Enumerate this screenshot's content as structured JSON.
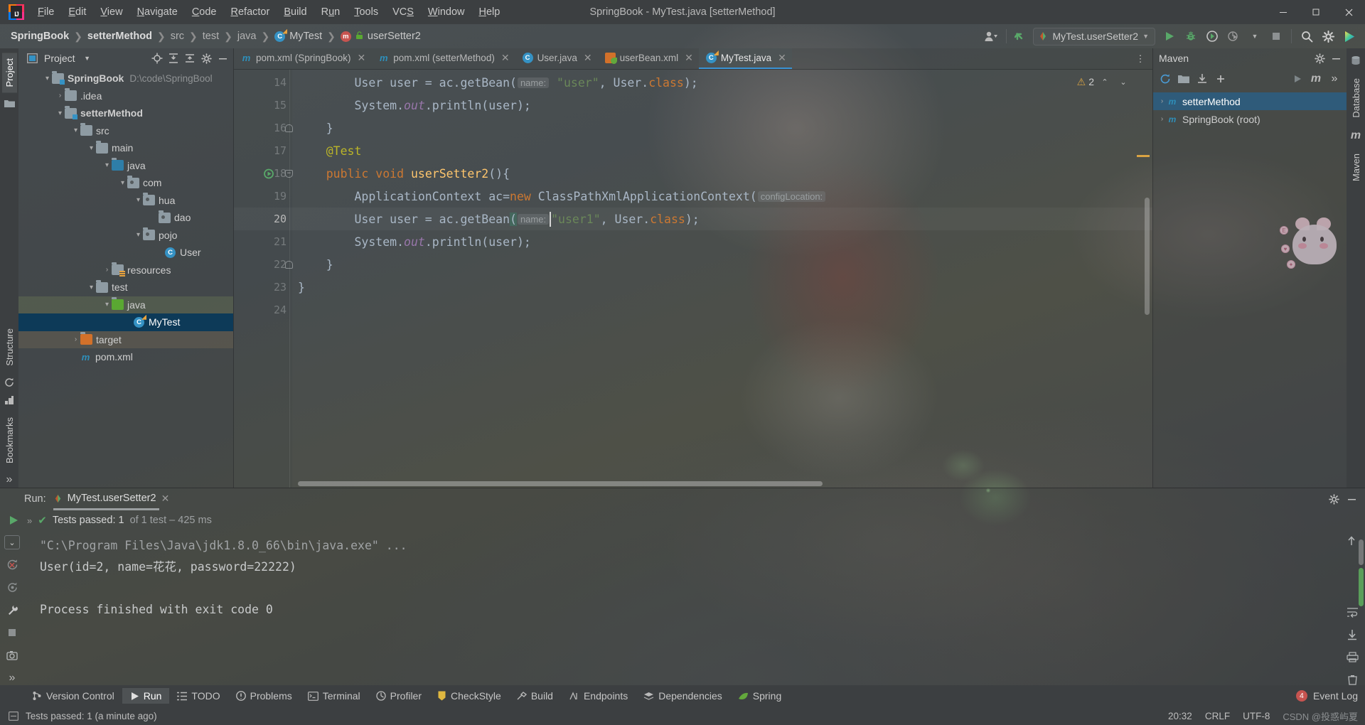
{
  "window": {
    "title": "SpringBook - MyTest.java [setterMethod]",
    "logo_text": "IJ",
    "minimize": "—",
    "maximize": "❐",
    "close": "✕"
  },
  "menu": [
    {
      "label": "File",
      "mnemonic": "F"
    },
    {
      "label": "Edit",
      "mnemonic": "E"
    },
    {
      "label": "View",
      "mnemonic": "V"
    },
    {
      "label": "Navigate",
      "mnemonic": "N"
    },
    {
      "label": "Code",
      "mnemonic": "C"
    },
    {
      "label": "Refactor",
      "mnemonic": "R"
    },
    {
      "label": "Build",
      "mnemonic": "B"
    },
    {
      "label": "Run",
      "mnemonic": "u"
    },
    {
      "label": "Tools",
      "mnemonic": "T"
    },
    {
      "label": "VCS",
      "mnemonic": "S"
    },
    {
      "label": "Window",
      "mnemonic": "W"
    },
    {
      "label": "Help",
      "mnemonic": "H"
    }
  ],
  "breadcrumbs": [
    {
      "label": "SpringBook",
      "style": "bold"
    },
    {
      "label": "setterMethod",
      "style": "bold"
    },
    {
      "label": "src",
      "style": "dim"
    },
    {
      "label": "test",
      "style": "dim"
    },
    {
      "label": "java",
      "style": "dim"
    },
    {
      "label": "MyTest",
      "style": "normal",
      "icon": "java-class-icon"
    },
    {
      "label": "userSetter2",
      "style": "normal",
      "icon": "method-icon"
    }
  ],
  "navbar_right": {
    "run_config": "MyTest.userSetter2",
    "icons": [
      "user-avatar-icon",
      "vcs-update-icon",
      "run-icon",
      "debug-icon",
      "run-with-coverage-icon",
      "profiler-icon",
      "stop-icon",
      "search-everywhere-icon",
      "settings-gear-icon",
      "ide-services-icon"
    ]
  },
  "left_stripe": {
    "tabs": [
      "Project"
    ],
    "extra_icon": "structure-folder-icon"
  },
  "right_stripe": {
    "tabs": [
      "Database",
      "Maven"
    ]
  },
  "project_panel": {
    "title": "Project",
    "toolbar_icons": [
      "locate-icon",
      "expand-all-icon",
      "collapse-all-icon",
      "settings-gear-icon",
      "hide-icon"
    ],
    "tree": [
      {
        "label": "SpringBook",
        "path": "D:\\code\\SpringBool",
        "depth": 0,
        "arrow": "open",
        "icon": "module-folder-icon",
        "bold": true
      },
      {
        "label": ".idea",
        "depth": 1,
        "arrow": "closed",
        "icon": "folder-icon"
      },
      {
        "label": "setterMethod",
        "depth": 1,
        "arrow": "open",
        "icon": "module-folder-icon",
        "bold": true
      },
      {
        "label": "src",
        "depth": 2,
        "arrow": "open",
        "icon": "folder-icon"
      },
      {
        "label": "main",
        "depth": 3,
        "arrow": "open",
        "icon": "folder-icon"
      },
      {
        "label": "java",
        "depth": 4,
        "arrow": "open",
        "icon": "source-root-icon"
      },
      {
        "label": "com",
        "depth": 5,
        "arrow": "open",
        "icon": "package-icon"
      },
      {
        "label": "hua",
        "depth": 6,
        "arrow": "open",
        "icon": "package-icon"
      },
      {
        "label": "dao",
        "depth": 7,
        "arrow": "none",
        "icon": "package-icon"
      },
      {
        "label": "pojo",
        "depth": 6,
        "arrow": "open",
        "icon": "package-icon"
      },
      {
        "label": "User",
        "depth": 7,
        "arrow": "none",
        "icon": "java-class-icon"
      },
      {
        "label": "resources",
        "depth": 4,
        "arrow": "closed",
        "icon": "resource-root-icon"
      },
      {
        "label": "test",
        "depth": 3,
        "arrow": "open",
        "icon": "folder-icon"
      },
      {
        "label": "java",
        "depth": 4,
        "arrow": "open",
        "icon": "test-source-root-icon",
        "state": "sel-java"
      },
      {
        "label": "MyTest",
        "depth": 5,
        "arrow": "none",
        "icon": "java-test-class-icon",
        "state": "sel-mytest"
      },
      {
        "label": "target",
        "depth": 2,
        "arrow": "closed",
        "icon": "excluded-folder-icon",
        "state": "sel-target"
      },
      {
        "label": "pom.xml",
        "depth": 2,
        "arrow": "none",
        "icon": "maven-icon"
      }
    ]
  },
  "editor": {
    "tabs": [
      {
        "label": "pom.xml (SpringBook)",
        "icon": "maven-icon",
        "active": false
      },
      {
        "label": "pom.xml (setterMethod)",
        "icon": "maven-icon",
        "active": false
      },
      {
        "label": "User.java",
        "icon": "java-class-icon",
        "active": false
      },
      {
        "label": "userBean.xml",
        "icon": "spring-xml-icon",
        "active": false
      },
      {
        "label": "MyTest.java",
        "icon": "java-test-class-icon",
        "active": true
      }
    ],
    "inspection": {
      "warning_count": "2"
    },
    "line_numbers": [
      "14",
      "15",
      "16",
      "17",
      "18",
      "19",
      "20",
      "21",
      "22",
      "23",
      "24"
    ],
    "current_line": "20",
    "lines": [
      {
        "n": "14",
        "segments": [
          {
            "t": "        User user = ac.getBean(",
            "c": "ident"
          },
          {
            "t": "name:",
            "c": "hint"
          },
          {
            "t": " ",
            "c": "ident"
          },
          {
            "t": "\"user\"",
            "c": "str"
          },
          {
            "t": ", User.",
            "c": "ident"
          },
          {
            "t": "class",
            "c": "kw"
          },
          {
            "t": ");",
            "c": "ident"
          }
        ]
      },
      {
        "n": "15",
        "segments": [
          {
            "t": "        System.",
            "c": "ident"
          },
          {
            "t": "out",
            "c": "fld"
          },
          {
            "t": ".println(user);",
            "c": "ident"
          }
        ]
      },
      {
        "n": "16",
        "fold": "bot",
        "segments": [
          {
            "t": "    }",
            "c": "ident"
          }
        ]
      },
      {
        "n": "17",
        "segments": [
          {
            "t": "    @Test",
            "c": "ann"
          }
        ]
      },
      {
        "n": "18",
        "runmark": true,
        "fold": "top",
        "segments": [
          {
            "t": "    public void ",
            "c": "kw"
          },
          {
            "t": "userSetter2",
            "c": "method"
          },
          {
            "t": "(){",
            "c": "ident"
          }
        ]
      },
      {
        "n": "19",
        "segments": [
          {
            "t": "        ApplicationContext ac=",
            "c": "ident"
          },
          {
            "t": "new",
            "c": "kw"
          },
          {
            "t": " ClassPathXmlApplicationContext(",
            "c": "ident"
          },
          {
            "t": "configLocation:",
            "c": "hint"
          }
        ]
      },
      {
        "n": "20",
        "current": true,
        "segments": [
          {
            "t": "        User user = ac.getBean(",
            "c": "ident"
          },
          {
            "t": "name:",
            "c": "hint"
          },
          {
            "t": "\"user1\"",
            "c": "str"
          },
          {
            "t": ", User.",
            "c": "ident"
          },
          {
            "t": "class",
            "c": "kw"
          },
          {
            "t": ");",
            "c": "ident"
          }
        ]
      },
      {
        "n": "21",
        "segments": [
          {
            "t": "        System.",
            "c": "ident"
          },
          {
            "t": "out",
            "c": "fld"
          },
          {
            "t": ".println(user);",
            "c": "ident"
          }
        ]
      },
      {
        "n": "22",
        "fold": "bot",
        "segments": [
          {
            "t": "    }",
            "c": "ident"
          }
        ]
      },
      {
        "n": "23",
        "segments": [
          {
            "t": "}",
            "c": "ident"
          }
        ]
      },
      {
        "n": "24",
        "segments": [
          {
            "t": "",
            "c": "ident"
          }
        ]
      }
    ]
  },
  "maven_panel": {
    "title": "Maven",
    "toolbar_icons": [
      "reload-icon",
      "add-folder-icon",
      "download-icon",
      "plus-icon",
      "run-maven-icon",
      "maven-goal-icon",
      "expand-chevrons-icon",
      "settings-gear-icon",
      "hide-icon"
    ],
    "items": [
      {
        "label": "setterMethod",
        "selected": true,
        "arrow": "closed"
      },
      {
        "label": "SpringBook (root)",
        "selected": false,
        "arrow": "closed"
      }
    ]
  },
  "run_panel": {
    "label": "Run:",
    "tab": "MyTest.userSetter2",
    "status_text": "Tests passed: 1",
    "status_suffix": " of 1 test – 425 ms",
    "left_icons": [
      "rerun-icon",
      "rerun-failed-icon",
      "toggle-auto-test-icon",
      "settings-wrench-icon",
      "stop-icon",
      "screenshot-icon",
      "more-icon"
    ],
    "right_icons": [
      "scroll-up-icon",
      "scroll-down-icon",
      "soft-wrap-icon",
      "scroll-to-end-icon",
      "print-icon",
      "clear-all-icon"
    ],
    "header_icons": [
      "settings-gear-icon",
      "hide-icon"
    ],
    "console": [
      {
        "text": "\"C:\\Program Files\\Java\\jdk1.8.0_66\\bin\\java.exe\" ...",
        "class": "cmdline"
      },
      {
        "text": "User(id=2, name=花花, password=22222)",
        "class": ""
      },
      {
        "text": "",
        "class": ""
      },
      {
        "text": "Process finished with exit code 0",
        "class": ""
      }
    ]
  },
  "bottom_bar": {
    "items": [
      {
        "label": "Version Control",
        "icon": "vcs-branch-icon",
        "active": false
      },
      {
        "label": "Run",
        "icon": "run-icon",
        "active": true
      },
      {
        "label": "TODO",
        "icon": "todo-list-icon",
        "active": false
      },
      {
        "label": "Problems",
        "icon": "problems-icon",
        "active": false
      },
      {
        "label": "Terminal",
        "icon": "terminal-icon",
        "active": false
      },
      {
        "label": "Profiler",
        "icon": "profiler-icon",
        "active": false
      },
      {
        "label": "CheckStyle",
        "icon": "checkstyle-icon",
        "active": false
      },
      {
        "label": "Build",
        "icon": "build-hammer-icon",
        "active": false
      },
      {
        "label": "Endpoints",
        "icon": "endpoints-icon",
        "active": false
      },
      {
        "label": "Dependencies",
        "icon": "dependencies-icon",
        "active": false
      },
      {
        "label": "Spring",
        "icon": "spring-leaf-icon",
        "active": false
      }
    ],
    "event_log": {
      "label": "Event Log",
      "badge": "4"
    }
  },
  "status_bar": {
    "message": "Tests passed: 1 (a minute ago)",
    "time": "20:32",
    "line_sep": "CRLF",
    "encoding": "UTF-8",
    "watermark": "CSDN @投惑屿夏"
  },
  "colors": {
    "accent_blue": "#3592c4",
    "green_run": "#59a869",
    "warn_yellow": "#d9a343",
    "selection_blue": "#0d3a58",
    "string_green": "#6a8759",
    "keyword_orange": "#cc7832",
    "annotation_yellow": "#bbb529",
    "field_purple": "#9876aa"
  }
}
